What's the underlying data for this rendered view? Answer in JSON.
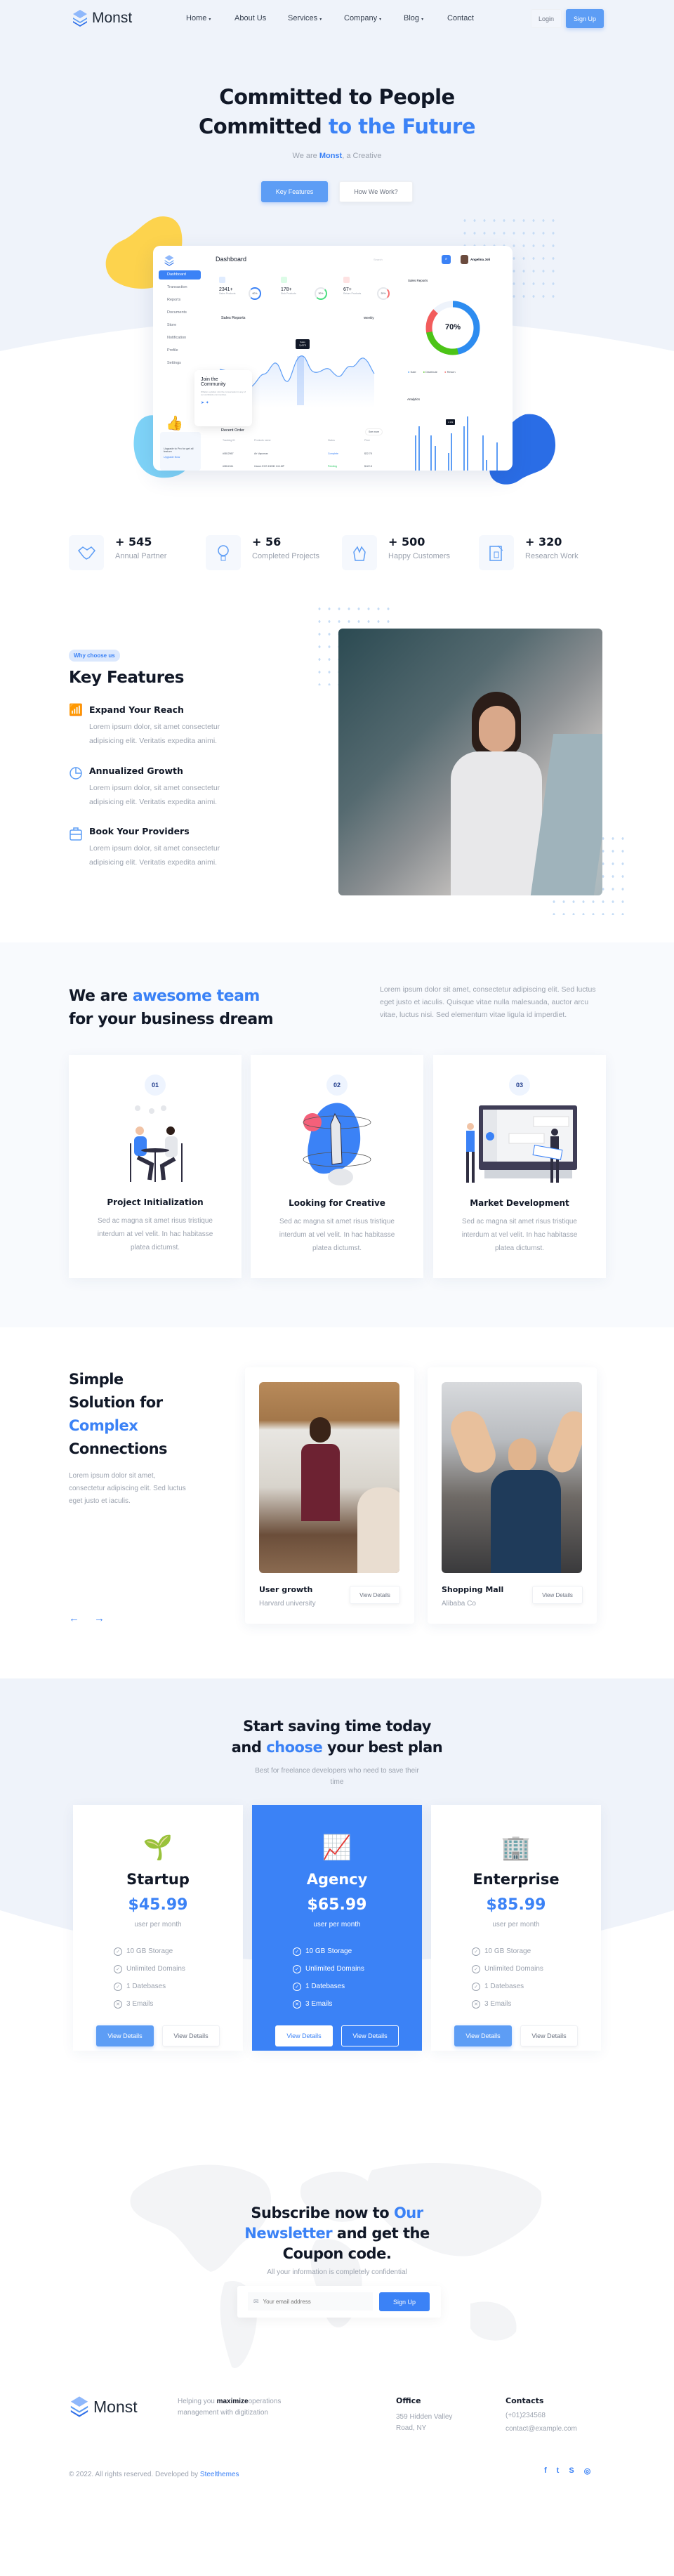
{
  "brand": {
    "name": "Monst",
    "accent": "#3b82f6",
    "hero_bg": "#eff3fa"
  },
  "nav": {
    "items": [
      {
        "label": "Home",
        "dropdown": true
      },
      {
        "label": "About Us",
        "dropdown": false
      },
      {
        "label": "Services",
        "dropdown": true
      },
      {
        "label": "Company",
        "dropdown": true
      },
      {
        "label": "Blog",
        "dropdown": true
      },
      {
        "label": "Contact",
        "dropdown": false
      }
    ],
    "login": "Login",
    "signup": "Sign Up"
  },
  "hero": {
    "line1": "Committed to People",
    "line2_a": "Committed ",
    "line2_b": "to the Future",
    "sub_a": "We are ",
    "sub_b": "Monst",
    "sub_c": ", a Creative",
    "btn_primary": "Key Features",
    "btn_secondary": "How We Work?"
  },
  "dashboard": {
    "title": "Dashboard",
    "search": "Search",
    "user": "Angelina Joli",
    "sidebar": [
      "Dashboard",
      "Transaction",
      "Reports",
      "Documents",
      "Store",
      "Notification",
      "Profile",
      "Settings"
    ],
    "stats": [
      {
        "value": "2341+",
        "label": "Sales Products",
        "pct": "60%"
      },
      {
        "value": "178+",
        "label": "Stok Products",
        "pct": "30%"
      },
      {
        "value": "67+",
        "label": "Return Products",
        "pct": "20%"
      }
    ],
    "sales_title": "Sales Reports",
    "period": "Weekly",
    "tooltip_label": "Sales",
    "tooltip_value": "3,672",
    "donut_title": "Sales Reports",
    "donut_value": "70%",
    "legend": [
      "Sale",
      "Distribute",
      "Return"
    ],
    "analytics": "Analytics",
    "bar_tooltip": "2.10k",
    "community_title": "Join the Community",
    "community_text": "Whatsn a global. Join the conversation in any of our worldwide communities.",
    "orders_title": "Recent Order",
    "see_more": "See more",
    "order_headers": [
      "Tracking ID",
      "Products name",
      "Status",
      "Price"
    ],
    "orders": [
      [
        "#0812567",
        "Air Vapomax",
        "Complete",
        "$22.78"
      ],
      [
        "#0812411",
        "Canon EOS 1500D 24.1MP",
        "Pending",
        "$122.8"
      ]
    ],
    "upgrade_text": "Upgrade to Pro for get all feature",
    "upgrade_link": "Upgrade Now"
  },
  "stats": [
    {
      "value": "+ 545",
      "label": "Annual Partner",
      "icon": "handshake-icon"
    },
    {
      "value": "+ 56",
      "label": "Completed Projects",
      "icon": "lightbulb-icon"
    },
    {
      "value": "+ 500",
      "label": "Happy Customers",
      "icon": "clap-icon"
    },
    {
      "value": "+ 320",
      "label": "Research Work",
      "icon": "blueprint-icon"
    }
  ],
  "features": {
    "badge": "Why choose us",
    "title": "Key Features",
    "items": [
      {
        "title": "Expand Your Reach",
        "text": "Lorem ipsum dolor, sit amet consectetur adipisicing elit. Veritatis expedita animi.",
        "icon": "growth-chart-icon"
      },
      {
        "title": "Annualized Growth",
        "text": "Lorem ipsum dolor, sit amet consectetur adipisicing elit. Veritatis expedita animi.",
        "icon": "pie-icon"
      },
      {
        "title": "Book Your Providers",
        "text": "Lorem ipsum dolor, sit amet consectetur adipisicing elit. Veritatis expedita animi.",
        "icon": "briefcase-icon"
      }
    ]
  },
  "team": {
    "title_a": "We are ",
    "title_b": "awesome team",
    "title_c": "for your business dream",
    "text": "Lorem ipsum dolor sit amet, consectetur adipiscing elit. Sed luctus eget justo et iaculis. Quisque vitae nulla malesuada, auctor arcu vitae, luctus nisi. Sed elementum vitae ligula id imperdiet.",
    "cards": [
      {
        "num": "01",
        "title": "Project Initialization",
        "text": "Sed ac magna sit amet risus tristique interdum at vel velit. In hac habitasse platea dictumst."
      },
      {
        "num": "02",
        "title": "Looking for Creative",
        "text": "Sed ac magna sit amet risus tristique interdum at vel velit. In hac habitasse platea dictumst."
      },
      {
        "num": "03",
        "title": "Market Development",
        "text": "Sed ac magna sit amet risus tristique interdum at vel velit. In hac habitasse platea dictumst."
      }
    ]
  },
  "solutions": {
    "l1": "Simple",
    "l2": "Solution for",
    "l3": "Complex",
    "l4": "Connections",
    "text": "Lorem ipsum dolor sit amet, consectetur adipiscing elit. Sed luctus eget justo et iaculis.",
    "cards": [
      {
        "title": "User growth",
        "sub": "Harvard university",
        "btn": "View Details"
      },
      {
        "title": "Shopping Mall",
        "sub": "Alibaba Co",
        "btn": "View Details"
      }
    ]
  },
  "pricing": {
    "title_a": "Start saving time today",
    "title_b": "and ",
    "title_c": "choose",
    "title_d": " your best plan",
    "sub": "Best for freelance developers who need to save their time",
    "plans": [
      {
        "name": "Startup",
        "price": "$45.99",
        "per": "user per month",
        "highlighted": false
      },
      {
        "name": "Agency",
        "price": "$65.99",
        "per": "user per month",
        "highlighted": true
      },
      {
        "name": "Enterprise",
        "price": "$85.99",
        "per": "user per month",
        "highlighted": false
      }
    ],
    "features": [
      {
        "label": "10 GB Storage",
        "included": true
      },
      {
        "label": "Unlimited Domains",
        "included": true
      },
      {
        "label": "1 Datebases",
        "included": true
      },
      {
        "label": "3 Emails",
        "included": false
      }
    ],
    "btn": "View Details"
  },
  "newsletter": {
    "t1": "Subscribe now to ",
    "t2": "Our",
    "t3": "Newsletter",
    "t4": " and get the",
    "t5": "Coupon code.",
    "sub": "All your information is completely confidential",
    "placeholder": "Your email address",
    "btn": "Sign Up"
  },
  "footer": {
    "tag_a": "Helping you ",
    "tag_b": "maximize",
    "tag_c": "operations management with digitization",
    "office_title": "Office",
    "office_l1": "359 Hidden Valley",
    "office_l2": "Road, NY",
    "contacts_title": "Contacts",
    "phone": "(+01)234568",
    "email": "contact@example.com",
    "copy": "© 2022. All rights reserved. Developed by ",
    "dev": "Steelthemes",
    "socials": [
      "facebook-icon",
      "twitter-icon",
      "skype-icon",
      "instagram-icon"
    ]
  }
}
